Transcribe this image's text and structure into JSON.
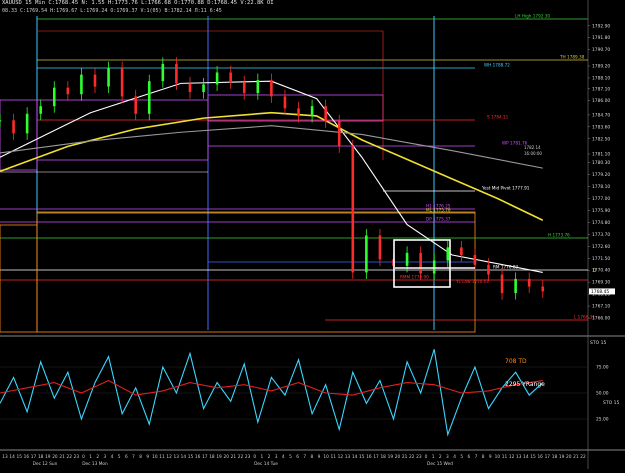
{
  "header": {
    "line1": "XAUUSD 15 Min  C:1768.45  N:  1.55  H:1773.76  L:1766.68  O:1770.88  D:1768.45  V:22.8K  OI",
    "line2": "08.33  C:1769.54  H:1769.67  L:1769.24  O:1769.37  V:1(05)  B:1782.14  Л:11  6:45"
  },
  "chart_data": [
    {
      "type": "line",
      "panel": "price",
      "ylim": [
        1764.9,
        1793.8
      ],
      "y_ticks": [
        "1792.90",
        "1791.80",
        "1790.70",
        "1789.20",
        "1788.10",
        "1787.10",
        "1786.00",
        "1784.70",
        "1783.60",
        "1782.50",
        "1781.10",
        "1780.30",
        "1779.20",
        "1778.10",
        "1777.00",
        "1775.90",
        "1774.80",
        "1773.70",
        "1772.60",
        "1771.50",
        "1770.40",
        "1769.30",
        "1768.20",
        "1767.10",
        "1766.00"
      ],
      "series": [
        {
          "role": "price",
          "color": "#2eff2e",
          "down_color": "#ff2a2a",
          "x": [
            0,
            3,
            6,
            9,
            12,
            15,
            18,
            21,
            24,
            27,
            30,
            33,
            36,
            39,
            42,
            45,
            48,
            51,
            54,
            57,
            60,
            63,
            66,
            69,
            72,
            75,
            78,
            81,
            84,
            87,
            90,
            93,
            96,
            99,
            102,
            105,
            108,
            111,
            114,
            117,
            120
          ],
          "values": [
            1784.2,
            1783.0,
            1784.8,
            1785.5,
            1787.2,
            1786.6,
            1788.4,
            1787.3,
            1789.0,
            1786.4,
            1784.8,
            1787.8,
            1789.4,
            1787.6,
            1786.8,
            1787.5,
            1788.6,
            1787.7,
            1786.7,
            1787.9,
            1786.4,
            1785.3,
            1784.6,
            1785.5,
            1784.1,
            1781.8,
            1770.2,
            1773.6,
            1771.4,
            1770.8,
            1772.0,
            1770.1,
            1771.3,
            1772.5,
            1771.8,
            1770.9,
            1770.0,
            1768.3,
            1769.6,
            1768.9,
            1768.45
          ]
        },
        {
          "role": "ma_white",
          "color": "#ffffff",
          "x": [
            0,
            20,
            40,
            60,
            70,
            80,
            90,
            100,
            110,
            120
          ],
          "values": [
            1780.8,
            1784.9,
            1787.6,
            1787.8,
            1786.2,
            1780.8,
            1774.6,
            1771.8,
            1771.0,
            1770.2
          ]
        },
        {
          "role": "ma_yellow",
          "color": "#f0e030",
          "x": [
            0,
            15,
            30,
            45,
            60,
            70,
            80,
            90,
            100,
            110,
            120
          ],
          "values": [
            1779.5,
            1781.8,
            1783.4,
            1784.4,
            1784.9,
            1784.6,
            1782.4,
            1780.6,
            1778.8,
            1777.0,
            1775.0
          ]
        },
        {
          "role": "ma_gray",
          "color": "#9a9a9a",
          "x": [
            0,
            20,
            40,
            60,
            80,
            100,
            120
          ],
          "values": [
            1781.2,
            1782.3,
            1783.1,
            1783.7,
            1782.9,
            1781.4,
            1779.8
          ]
        }
      ]
    },
    {
      "type": "line",
      "panel": "stochastic",
      "ylim": [
        0,
        100
      ],
      "y_ticks": [
        "25.00",
        "50.00",
        "75.00"
      ],
      "series": [
        {
          "role": "fast",
          "color": "#3ad7ff",
          "x": [
            0,
            3,
            6,
            9,
            12,
            15,
            18,
            21,
            24,
            27,
            30,
            33,
            36,
            39,
            42,
            45,
            48,
            51,
            54,
            57,
            60,
            63,
            66,
            69,
            72,
            75,
            78,
            81,
            84,
            87,
            90,
            93,
            96,
            99,
            102,
            105,
            108,
            111,
            114,
            117,
            120
          ],
          "values": [
            40,
            65,
            32,
            80,
            45,
            70,
            25,
            60,
            85,
            30,
            55,
            20,
            75,
            50,
            88,
            35,
            60,
            42,
            78,
            22,
            65,
            48,
            82,
            30,
            58,
            15,
            70,
            40,
            62,
            25,
            80,
            50,
            92,
            10,
            45,
            75,
            35,
            55,
            70,
            48,
            60
          ]
        },
        {
          "role": "slow",
          "color": "#e02020",
          "x": [
            0,
            6,
            12,
            18,
            24,
            30,
            36,
            42,
            48,
            54,
            60,
            66,
            72,
            78,
            84,
            90,
            96,
            102,
            108,
            114,
            120
          ],
          "values": [
            50,
            55,
            60,
            50,
            62,
            48,
            52,
            60,
            55,
            58,
            52,
            60,
            50,
            48,
            55,
            60,
            58,
            50,
            52,
            58,
            62
          ]
        }
      ]
    }
  ],
  "x_ticks": [
    "13",
    "14",
    "15",
    "16",
    "17",
    "18",
    "19",
    "20",
    "21",
    "22",
    "23",
    "0",
    "1",
    "2",
    "3",
    "4",
    "5",
    "6",
    "7",
    "8",
    "9",
    "10",
    "11",
    "12",
    "13",
    "14",
    "15",
    "16",
    "17",
    "18",
    "19",
    "20",
    "21",
    "22",
    "23",
    "0",
    "1",
    "2",
    "3",
    "4",
    "5",
    "6",
    "7",
    "8",
    "9",
    "10",
    "11",
    "12",
    "13",
    "14",
    "15",
    "16",
    "17",
    "18",
    "19",
    "20",
    "21",
    "22",
    "23",
    "0",
    "1",
    "2",
    "3",
    "4",
    "5",
    "6",
    "7",
    "8",
    "9",
    "10",
    "11",
    "12",
    "13",
    "14",
    "15",
    "16",
    "17",
    "18",
    "19",
    "20",
    "21",
    "22"
  ],
  "date_labels": [
    "Dec 12 Sun",
    "Dec 13 Mon",
    "Dec 14 Tue",
    "Dec 15 Wed"
  ],
  "level_labels": [
    {
      "text": "LH High 1792.30",
      "color": "#3ad13a"
    },
    {
      "text": "TH 1789.38",
      "color": "#d8c040"
    },
    {
      "text": "WH 1788.72",
      "color": "#3ad7ff"
    },
    {
      "text": "S 1784.11",
      "color": "#ff3030"
    },
    {
      "text": "WP 1781.76",
      "color": "#d050ff"
    },
    {
      "text": "1782.14",
      "color": "#cccccc"
    },
    {
      "text": "16:00:00",
      "color": "#cccccc"
    },
    {
      "text": "Yest Mid Pivot 1777.91",
      "color": "#ffffff"
    },
    {
      "text": "H1 1776.25",
      "color": "#d050ff"
    },
    {
      "text": "ML 1775.76",
      "color": "#d8c040"
    },
    {
      "text": "DP 1775.37",
      "color": "#d050ff"
    },
    {
      "text": "H 1773.76",
      "color": "#3ad13a"
    },
    {
      "text": "RM 1770.83",
      "color": "#ffffff"
    },
    {
      "text": "RMM 1770.90",
      "color": "#ff3030"
    },
    {
      "text": "YL Low 1770.01",
      "color": "#ff3030"
    },
    {
      "text": "D",
      "color": "#d8c040"
    },
    {
      "text": "L 1768.31",
      "color": "#ff3030"
    }
  ],
  "price_marker": "1768.45",
  "stoch_labels": {
    "td": "708 TD",
    "range": "2295 YRange",
    "sto_top": "STO 15",
    "sto_mid": "STO 15"
  }
}
